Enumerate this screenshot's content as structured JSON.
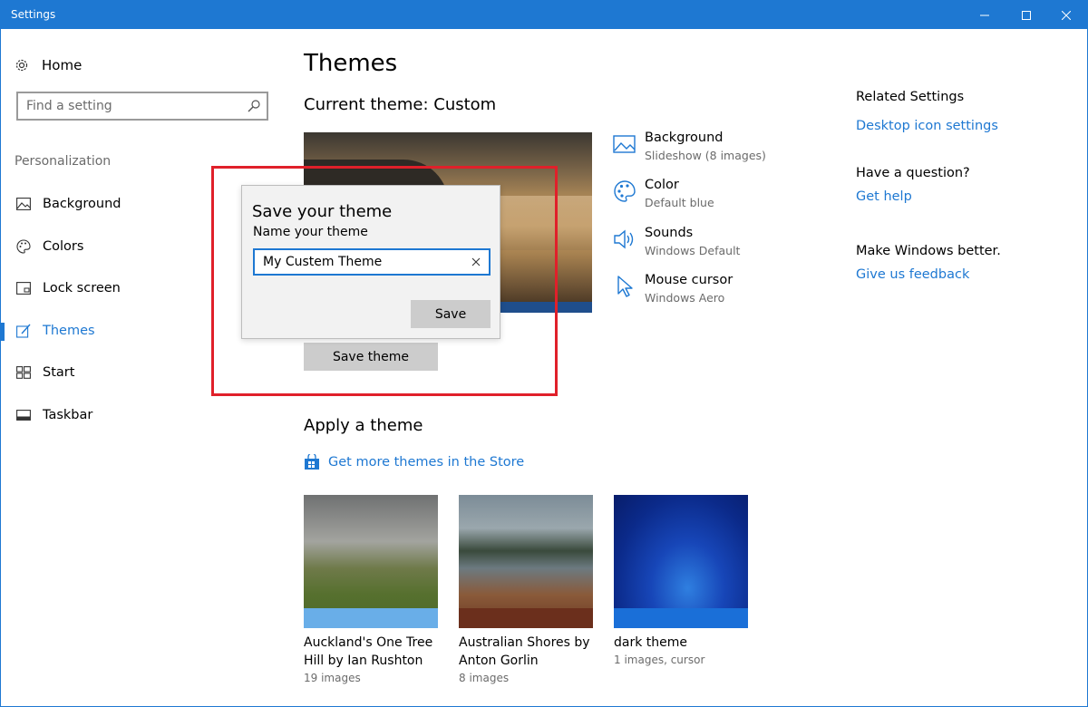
{
  "window": {
    "title": "Settings"
  },
  "sidebar": {
    "home_label": "Home",
    "search_placeholder": "Find a setting",
    "section_label": "Personalization",
    "items": [
      {
        "label": "Background",
        "icon": "image-icon"
      },
      {
        "label": "Colors",
        "icon": "palette-icon"
      },
      {
        "label": "Lock screen",
        "icon": "lock-screen-icon"
      },
      {
        "label": "Themes",
        "icon": "themes-icon",
        "active": true
      },
      {
        "label": "Start",
        "icon": "start-icon"
      },
      {
        "label": "Taskbar",
        "icon": "taskbar-icon"
      }
    ]
  },
  "main": {
    "title": "Themes",
    "current_theme": "Current theme: Custom",
    "properties": [
      {
        "name": "Background",
        "value": "Slideshow (8 images)",
        "icon": "background-icon"
      },
      {
        "name": "Color",
        "value": "Default blue",
        "icon": "palette-icon"
      },
      {
        "name": "Sounds",
        "value": "Windows Default",
        "icon": "speaker-icon"
      },
      {
        "name": "Mouse cursor",
        "value": "Windows Aero",
        "icon": "cursor-icon"
      }
    ],
    "save_theme_label": "Save theme",
    "apply_title": "Apply a theme",
    "store_link": "Get more themes in the Store",
    "themes": [
      {
        "name": "Auckland's One Tree Hill by Ian Rushton",
        "count": "19 images"
      },
      {
        "name": "Australian Shores by Anton Gorlin",
        "count": "8 images"
      },
      {
        "name": "dark theme",
        "count": "1 images, cursor"
      }
    ]
  },
  "dialog": {
    "title": "Save your theme",
    "label": "Name your theme",
    "input_value": "My Custem Theme",
    "save_label": "Save"
  },
  "related": {
    "title": "Related Settings",
    "desktop_icon_link": "Desktop icon settings",
    "question_title": "Have a question?",
    "help_link": "Get help",
    "better_title": "Make Windows better.",
    "feedback_link": "Give us feedback"
  },
  "colors": {
    "accent": "#1e78d2",
    "highlight": "#e0202a"
  }
}
